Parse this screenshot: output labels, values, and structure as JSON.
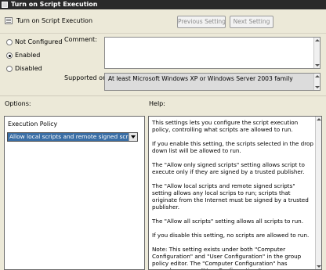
{
  "window": {
    "title": "Turn on Script Execution"
  },
  "header": {
    "policy_title": "Turn on Script Execution",
    "previous_label": "Previous Setting",
    "next_label": "Next Setting"
  },
  "state": {
    "options": [
      {
        "label": "Not Configured",
        "checked": false
      },
      {
        "label": "Enabled",
        "checked": true
      },
      {
        "label": "Disabled",
        "checked": false
      }
    ]
  },
  "comment": {
    "label": "Comment:",
    "value": ""
  },
  "supported": {
    "label": "Supported on:",
    "value": "At least Microsoft Windows XP or Windows Server 2003 family"
  },
  "options_panel": {
    "heading": "Options:",
    "execution_label": "Execution Policy",
    "selected": "Allow local scripts and remote signed scripts"
  },
  "help": {
    "heading": "Help:",
    "paragraphs": [
      "This settings lets you configure the script execution policy, controlling what scripts are allowed to run.",
      "If you enable this setting, the scripts selected in the drop down list will be allowed to run.",
      "The \"Allow only signed scripts\" setting allows script to execute only if they are signed by a trusted publisher.",
      "The \"Allow local scripts and remote signed scripts\" setting allows any local scrips to run; scripts that originate from the Internet must be signed by a trusted publisher.",
      "The \"Allow all scripts\" setting allows all scripts to run.",
      "If you disable this setting, no scripts are allowed to run.",
      "Note: This setting exists under both \"Computer Configuration\" and \"User Configuration\" in the group policy editor. The \"Computer Configuration\" has precedence over \"User Configuration.\""
    ]
  },
  "colors": {
    "dialog_bg": "#ece9d8",
    "titlebar_bg": "#2a2a2a",
    "selection": "#3a6ea5"
  },
  "icons": {
    "app": "app-icon",
    "policy": "policy-document-icon",
    "dropdown": "chevron-down-icon"
  }
}
